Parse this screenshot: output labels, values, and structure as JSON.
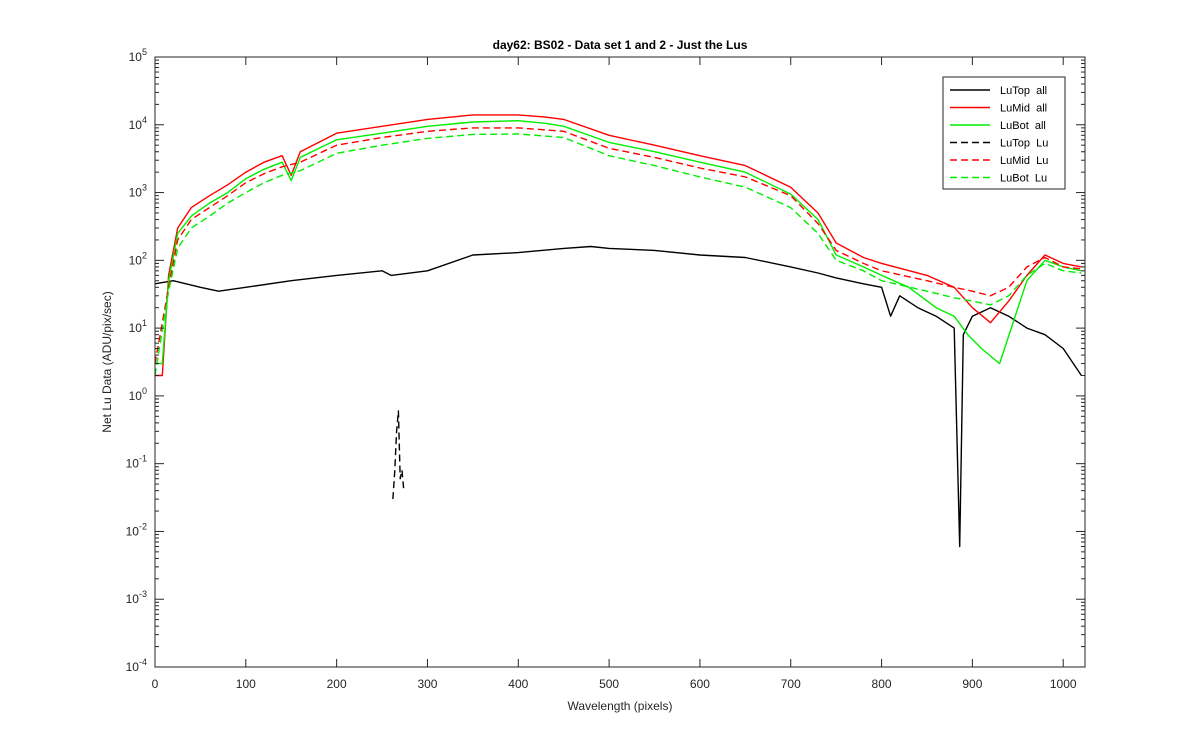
{
  "chart_data": {
    "type": "line",
    "title": "day62: BS02 - Data set 1 and 2 - Just the Lus",
    "xlabel": "Wavelength (pixels)",
    "ylabel": "Net Lu Data (ADU/pix/sec)",
    "xlim": [
      0,
      1024
    ],
    "ylim": [
      0.0001,
      100000
    ],
    "yscale": "log",
    "x_ticks": [
      0,
      100,
      200,
      300,
      400,
      500,
      600,
      700,
      800,
      900,
      1000
    ],
    "y_tick_exponents": [
      -4,
      -3,
      -2,
      -1,
      0,
      1,
      2,
      3,
      4,
      5
    ],
    "y_tick_base": "10",
    "grid": false,
    "legend_position": "top-right",
    "series": [
      {
        "name": "LuTop  all",
        "color": "#000000",
        "style": "solid",
        "x": [
          0,
          20,
          50,
          70,
          100,
          150,
          200,
          250,
          260,
          300,
          350,
          400,
          450,
          480,
          500,
          550,
          600,
          650,
          700,
          730,
          750,
          780,
          800,
          810,
          820,
          840,
          860,
          880,
          886,
          890,
          900,
          920,
          940,
          960,
          980,
          1000,
          1020
        ],
        "y": [
          45,
          50,
          40,
          35,
          40,
          50,
          60,
          70,
          60,
          70,
          120,
          130,
          150,
          160,
          150,
          140,
          120,
          110,
          80,
          65,
          55,
          45,
          40,
          15,
          30,
          20,
          15,
          10,
          0.006,
          8,
          15,
          20,
          15,
          10,
          8,
          5,
          2
        ]
      },
      {
        "name": "LuMid  all",
        "color": "#ff0000",
        "style": "solid",
        "x": [
          0,
          8,
          15,
          25,
          40,
          60,
          80,
          100,
          120,
          140,
          150,
          160,
          200,
          250,
          300,
          350,
          400,
          430,
          450,
          500,
          550,
          600,
          650,
          700,
          730,
          750,
          780,
          800,
          850,
          880,
          900,
          920,
          940,
          960,
          980,
          1000,
          1020
        ],
        "y": [
          2,
          2,
          60,
          300,
          600,
          900,
          1300,
          2000,
          2800,
          3500,
          1800,
          4000,
          7500,
          9500,
          12000,
          14000,
          14000,
          13000,
          12000,
          7000,
          5000,
          3500,
          2500,
          1200,
          500,
          180,
          110,
          90,
          60,
          40,
          20,
          12,
          25,
          60,
          120,
          90,
          80
        ]
      },
      {
        "name": "LuBot  all",
        "color": "#00ee00",
        "style": "solid",
        "x": [
          0,
          8,
          15,
          25,
          40,
          60,
          80,
          100,
          120,
          140,
          150,
          160,
          200,
          250,
          300,
          350,
          400,
          430,
          450,
          500,
          550,
          600,
          650,
          700,
          730,
          750,
          780,
          800,
          830,
          860,
          880,
          895,
          910,
          930,
          960,
          980,
          1000,
          1020
        ],
        "y": [
          3,
          3,
          50,
          250,
          450,
          700,
          1000,
          1600,
          2200,
          2800,
          1500,
          3300,
          6000,
          7500,
          9500,
          11000,
          11500,
          10500,
          9500,
          5500,
          4000,
          2800,
          2000,
          950,
          400,
          120,
          80,
          60,
          40,
          20,
          15,
          8,
          5,
          3,
          50,
          100,
          80,
          70
        ]
      },
      {
        "name": "LuTop  Lu",
        "color": "#000000",
        "style": "dashed",
        "x": [
          262,
          264,
          266,
          268,
          270,
          272,
          274
        ],
        "y": [
          0.03,
          0.08,
          0.3,
          0.6,
          0.06,
          0.08,
          0.04
        ]
      },
      {
        "name": "LuMid  Lu",
        "color": "#ff0000",
        "style": "dashed",
        "x": [
          0,
          15,
          25,
          40,
          60,
          80,
          100,
          120,
          140,
          160,
          200,
          250,
          300,
          350,
          400,
          450,
          500,
          550,
          600,
          650,
          700,
          730,
          750,
          780,
          800,
          850,
          880,
          900,
          920,
          940,
          960,
          980,
          1000,
          1020
        ],
        "y": [
          3,
          40,
          200,
          400,
          600,
          900,
          1400,
          1900,
          2400,
          2800,
          5000,
          6500,
          8000,
          9000,
          9000,
          8000,
          4500,
          3300,
          2300,
          1700,
          900,
          350,
          140,
          90,
          70,
          50,
          40,
          35,
          30,
          40,
          80,
          110,
          80,
          75
        ]
      },
      {
        "name": "LuBot  Lu",
        "color": "#00ee00",
        "style": "dashed",
        "x": [
          0,
          15,
          25,
          40,
          60,
          80,
          100,
          120,
          140,
          160,
          200,
          250,
          300,
          350,
          400,
          450,
          500,
          550,
          600,
          650,
          700,
          730,
          750,
          780,
          800,
          850,
          880,
          900,
          920,
          940,
          960,
          980,
          1000,
          1020
        ],
        "y": [
          2,
          35,
          150,
          300,
          450,
          700,
          1000,
          1400,
          1800,
          2100,
          3800,
          5000,
          6300,
          7200,
          7300,
          6500,
          3500,
          2500,
          1700,
          1200,
          600,
          250,
          100,
          70,
          50,
          35,
          28,
          25,
          22,
          30,
          60,
          90,
          70,
          65
        ]
      }
    ]
  }
}
